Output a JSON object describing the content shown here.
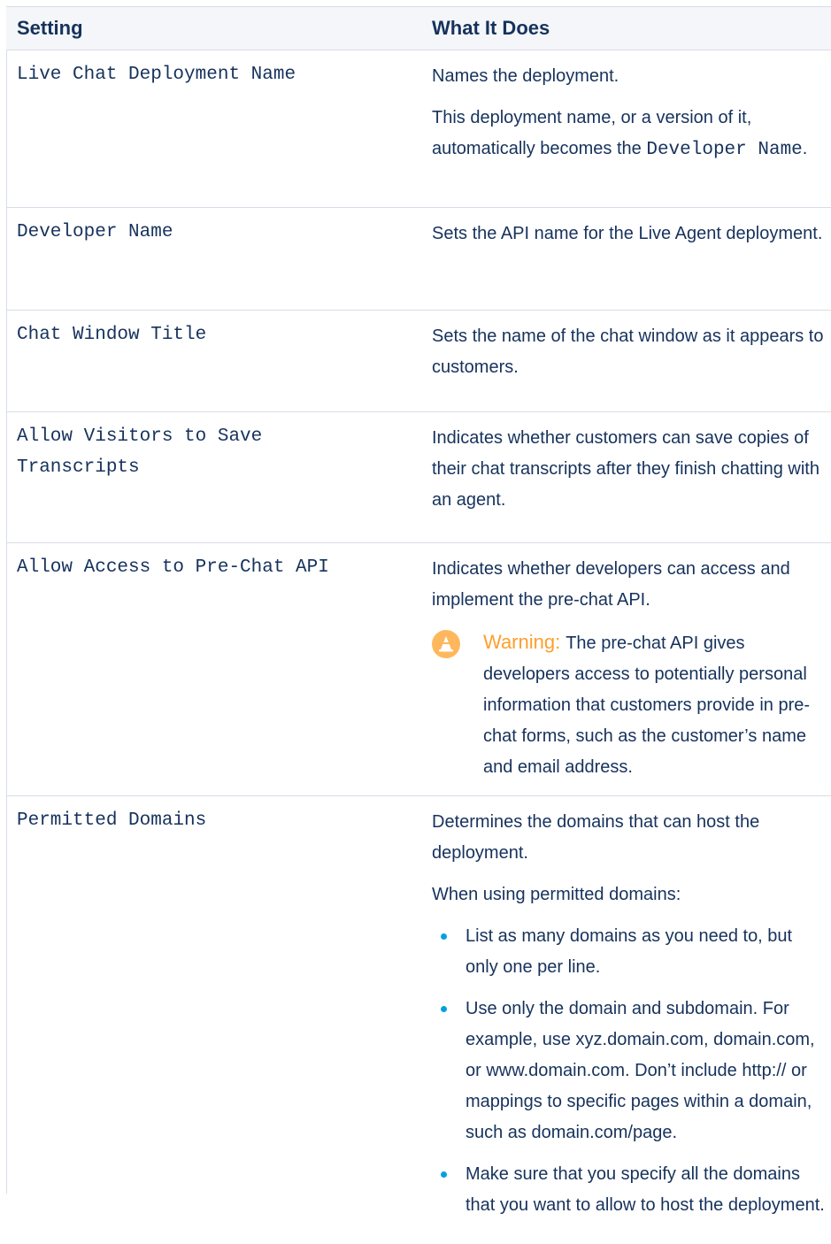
{
  "table": {
    "header": {
      "setting": "Setting",
      "what": "What It Does"
    },
    "rows": [
      {
        "setting": "Live Chat Deployment Name",
        "desc_p1": "Names the deployment.",
        "desc_p2_pre": "This deployment name, or a version of it, automatically becomes the ",
        "desc_p2_code": "Developer Name",
        "desc_p2_post": "."
      },
      {
        "setting": "Developer Name",
        "desc_p1": "Sets the API name for the Live Agent deployment."
      },
      {
        "setting": "Chat Window Title",
        "desc_p1": "Sets the name of the chat window as it appears to customers."
      },
      {
        "setting_line1": "Allow Visitors to Save",
        "setting_line2": "Transcripts",
        "desc_p1": "Indicates whether customers can save copies of their chat transcripts after they finish chatting with an agent."
      },
      {
        "setting": "Allow Access to Pre-Chat API",
        "desc_p1": "Indicates whether developers can access and implement the pre-chat API.",
        "warning_label": "Warning:",
        "warning_text": "The pre-chat API gives developers access to potentially personal information that customers provide in pre-chat forms, such as the customer’s name and email address."
      },
      {
        "setting": "Permitted Domains",
        "desc_p1": "Determines the domains that can host the deployment.",
        "desc_p2": "When using permitted domains:",
        "bullets": [
          "List as many domains as you need to, but only one per line.",
          "Use only the domain and subdomain. For example, use xyz.domain.com, domain.com, or www.domain.com. Don’t include http:// or mappings to specific pages within a domain, such as domain.com/page.",
          "Make sure that you specify all the domains that you want to allow to host the deployment."
        ]
      }
    ]
  },
  "colors": {
    "text": "#16325c",
    "header_bg": "#f4f6f9",
    "border": "#d8dde6",
    "warning": "#ff9e2c",
    "bullet": "#00a1e0"
  },
  "icons": {
    "warning": "warning-cone-icon"
  }
}
